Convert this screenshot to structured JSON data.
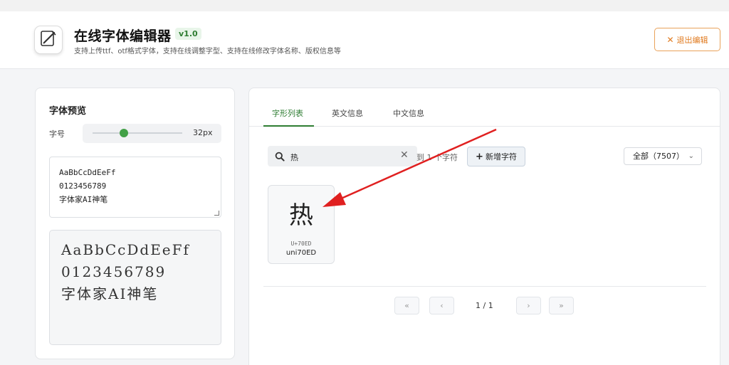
{
  "header": {
    "title": "在线字体编辑器",
    "version": "v1.0",
    "subtitle": "支持上传ttf、otf格式字体，支持在线调整字型、支持在线修改字体名称、版权信息等",
    "exit_label": "退出编辑",
    "logo_icon": "pen-edit-icon",
    "exit_icon": "close-icon",
    "accent_color": "#2e7d32",
    "exit_color": "#e07a1f"
  },
  "preview": {
    "title": "字体预览",
    "size_label": "字号",
    "size_value": "32px",
    "size_level": 0.35,
    "sample_lines": [
      "AaBbCcDdEeFf",
      "0123456789",
      "字体家AI神笔"
    ]
  },
  "tabs": [
    {
      "label": "字形列表",
      "active": true
    },
    {
      "label": "英文信息",
      "active": false
    },
    {
      "label": "中文信息",
      "active": false
    }
  ],
  "toolbar": {
    "search_value": "热",
    "search_icon": "search-icon",
    "clear_icon": "close-icon",
    "count_text": "到 1 个字符",
    "add_label": "新增字符",
    "add_icon": "plus-icon",
    "filter_value": "全部（7507）"
  },
  "glyphs": [
    {
      "char": "热",
      "code": "U+70ED",
      "name": "uni70ED"
    }
  ],
  "pagination": {
    "first": "«",
    "prev": "‹",
    "text": "1 / 1",
    "next": "›",
    "last": "»"
  },
  "annotation": {
    "arrow_color": "#e02020"
  }
}
